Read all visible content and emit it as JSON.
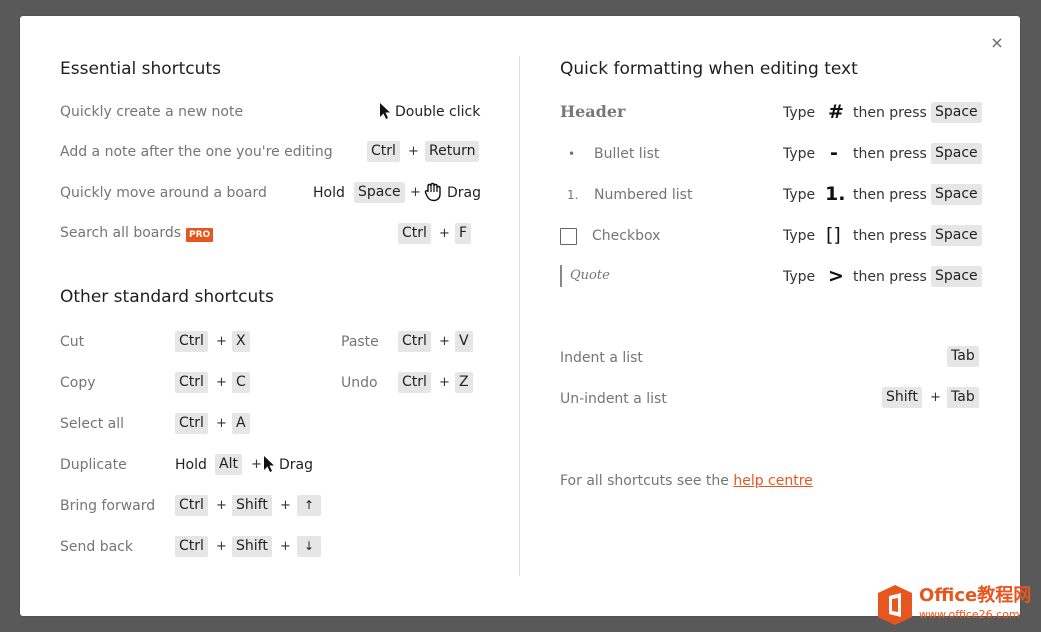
{
  "close_icon": "×",
  "essential": {
    "title": "Essential shortcuts",
    "row1": {
      "label": "Quickly create a new note",
      "action": "Double click"
    },
    "row2": {
      "label": "Add a note after the one you're editing",
      "k1": "Ctrl",
      "k2": "Return"
    },
    "row3": {
      "label": "Quickly move around a board",
      "hold": "Hold",
      "k1": "Space",
      "drag": "Drag"
    },
    "row4": {
      "label": "Search all boards",
      "badge": "PRO",
      "k1": "Ctrl",
      "k2": "F"
    }
  },
  "other": {
    "title": "Other standard shortcuts",
    "cut": {
      "label": "Cut",
      "k1": "Ctrl",
      "k2": "X"
    },
    "paste": {
      "label": "Paste",
      "k1": "Ctrl",
      "k2": "V"
    },
    "copy": {
      "label": "Copy",
      "k1": "Ctrl",
      "k2": "C"
    },
    "undo": {
      "label": "Undo",
      "k1": "Ctrl",
      "k2": "Z"
    },
    "select_all": {
      "label": "Select all",
      "k1": "Ctrl",
      "k2": "A"
    },
    "duplicate": {
      "label": "Duplicate",
      "hold": "Hold",
      "k1": "Alt",
      "drag": "Drag"
    },
    "bring_forward": {
      "label": "Bring forward",
      "k1": "Ctrl",
      "k2": "Shift",
      "k3": "↑"
    },
    "send_back": {
      "label": "Send back",
      "k1": "Ctrl",
      "k2": "Shift",
      "k3": "↓"
    }
  },
  "formatting": {
    "title": "Quick formatting when editing text",
    "type_word": "Type",
    "then_press": "then press",
    "space_key": "Space",
    "header": {
      "label": "Header",
      "symbol": "#"
    },
    "bullet": {
      "marker": "•",
      "label": "Bullet list",
      "symbol": "-"
    },
    "numbered": {
      "marker": "1.",
      "label": "Numbered list",
      "symbol": "1."
    },
    "checkbox": {
      "label": "Checkbox",
      "symbol": "[]"
    },
    "quote": {
      "label": "Quote",
      "symbol": ">"
    },
    "indent": {
      "label": "Indent a list",
      "k1": "Tab"
    },
    "unindent": {
      "label": "Un-indent a list",
      "k1": "Shift",
      "k2": "Tab"
    },
    "footer_prefix": "For all shortcuts see the",
    "footer_link": "help centre"
  },
  "plus_sign": "+",
  "colors": {
    "accent": "#e8561f",
    "backdrop": "#595959",
    "key_bg": "#e6e6e6"
  },
  "watermark": {
    "line1": "Office教程网",
    "line2": "www.office26.com"
  }
}
